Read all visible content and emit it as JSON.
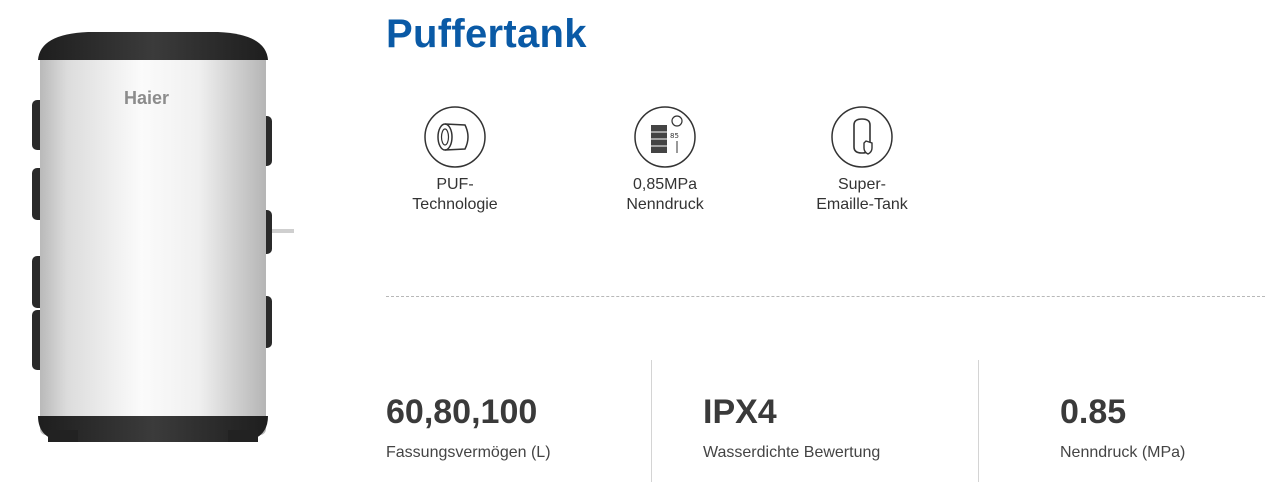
{
  "product": {
    "image_icon": "hot-water-buffer-tank-image",
    "brand_logo": "Haier"
  },
  "title": "Puffertank",
  "features": [
    {
      "icon": "puf-technology-icon",
      "label": "PUF-\nTechnologie"
    },
    {
      "icon": "pressure-building-icon",
      "label": "0,85MPa\nNenndruck",
      "icon_text": "85"
    },
    {
      "icon": "enamel-tank-shield-icon",
      "label": "Super-\nEmaille-Tank"
    }
  ],
  "stats": [
    {
      "value": "60,80,100",
      "label": "Fassungsvermögen (L)"
    },
    {
      "value": "IPX4",
      "label": "Wasserdichte Bewertung"
    },
    {
      "value": "0.85",
      "label": "Nenndruck (MPa)"
    }
  ],
  "colors": {
    "title": "#0a5aa6",
    "tank_body": "#e8e8e8",
    "tank_cap": "#2e2e2e"
  }
}
